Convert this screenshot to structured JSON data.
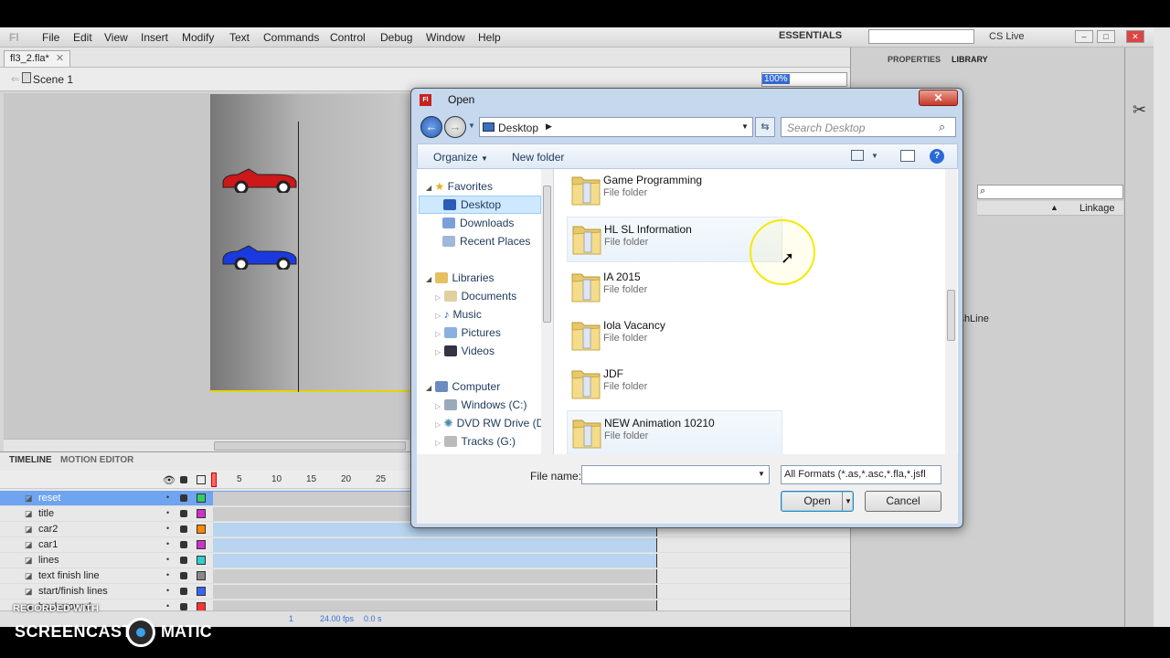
{
  "menu": {
    "items": [
      "File",
      "Edit",
      "View",
      "Insert",
      "Modify",
      "Text",
      "Commands",
      "Control",
      "Debug",
      "Window",
      "Help"
    ],
    "workspace": "ESSENTIALS",
    "cs_live": "CS Live"
  },
  "document": {
    "tab_label": "fl3_2.fla*",
    "scene_label": "Scene 1",
    "zoom": "100%"
  },
  "timeline": {
    "tabs": [
      "TIMELINE",
      "MOTION EDITOR"
    ],
    "frame_numbers": [
      "5",
      "10",
      "15",
      "20",
      "25"
    ],
    "layers": [
      {
        "name": "reset",
        "color": "#33cc66"
      },
      {
        "name": "title",
        "color": "#cc33cc"
      },
      {
        "name": "car2",
        "color": "#ff8800"
      },
      {
        "name": "car1",
        "color": "#cc33cc"
      },
      {
        "name": "lines",
        "color": "#33cccc"
      },
      {
        "name": "text finish line",
        "color": "#888888"
      },
      {
        "name": "start/finish lines",
        "color": "#3366ff"
      },
      {
        "name": "background",
        "color": "#ff3333"
      }
    ],
    "fps": "24.00 fps",
    "time": "0.0 s",
    "frame": "1"
  },
  "right_panel": {
    "tabs": [
      "PROPERTIES",
      "LIBRARY"
    ],
    "linkage_header": "Linkage",
    "visible_entry": "ishLine"
  },
  "dialog": {
    "title": "Open",
    "address": "Desktop",
    "search_placeholder": "Search Desktop",
    "organize": "Organize",
    "new_folder": "New folder",
    "nav": {
      "favorites": "Favorites",
      "desktop": "Desktop",
      "downloads": "Downloads",
      "recent": "Recent Places",
      "libraries": "Libraries",
      "documents": "Documents",
      "music": "Music",
      "pictures": "Pictures",
      "videos": "Videos",
      "computer": "Computer",
      "windows_c": "Windows (C:)",
      "dvd": "DVD RW Drive (D",
      "tracks": "Tracks (G:)"
    },
    "files": [
      {
        "name": "Game Programming",
        "type": "File folder"
      },
      {
        "name": "HL SL Information",
        "type": "File folder"
      },
      {
        "name": "IA 2015",
        "type": "File folder"
      },
      {
        "name": "Iola Vacancy",
        "type": "File folder"
      },
      {
        "name": "JDF",
        "type": "File folder"
      },
      {
        "name": "NEW Animation 10210",
        "type": "File folder"
      }
    ],
    "file_name_label": "File name:",
    "file_name_value": "",
    "format": "All Formats (*.as,*.asc,*.fla,*.jsfl",
    "open_button": "Open",
    "cancel_button": "Cancel"
  },
  "watermark": {
    "line1": "RECORDED WITH",
    "brand_left": "SCREENCAST",
    "brand_right": "MATIC"
  }
}
